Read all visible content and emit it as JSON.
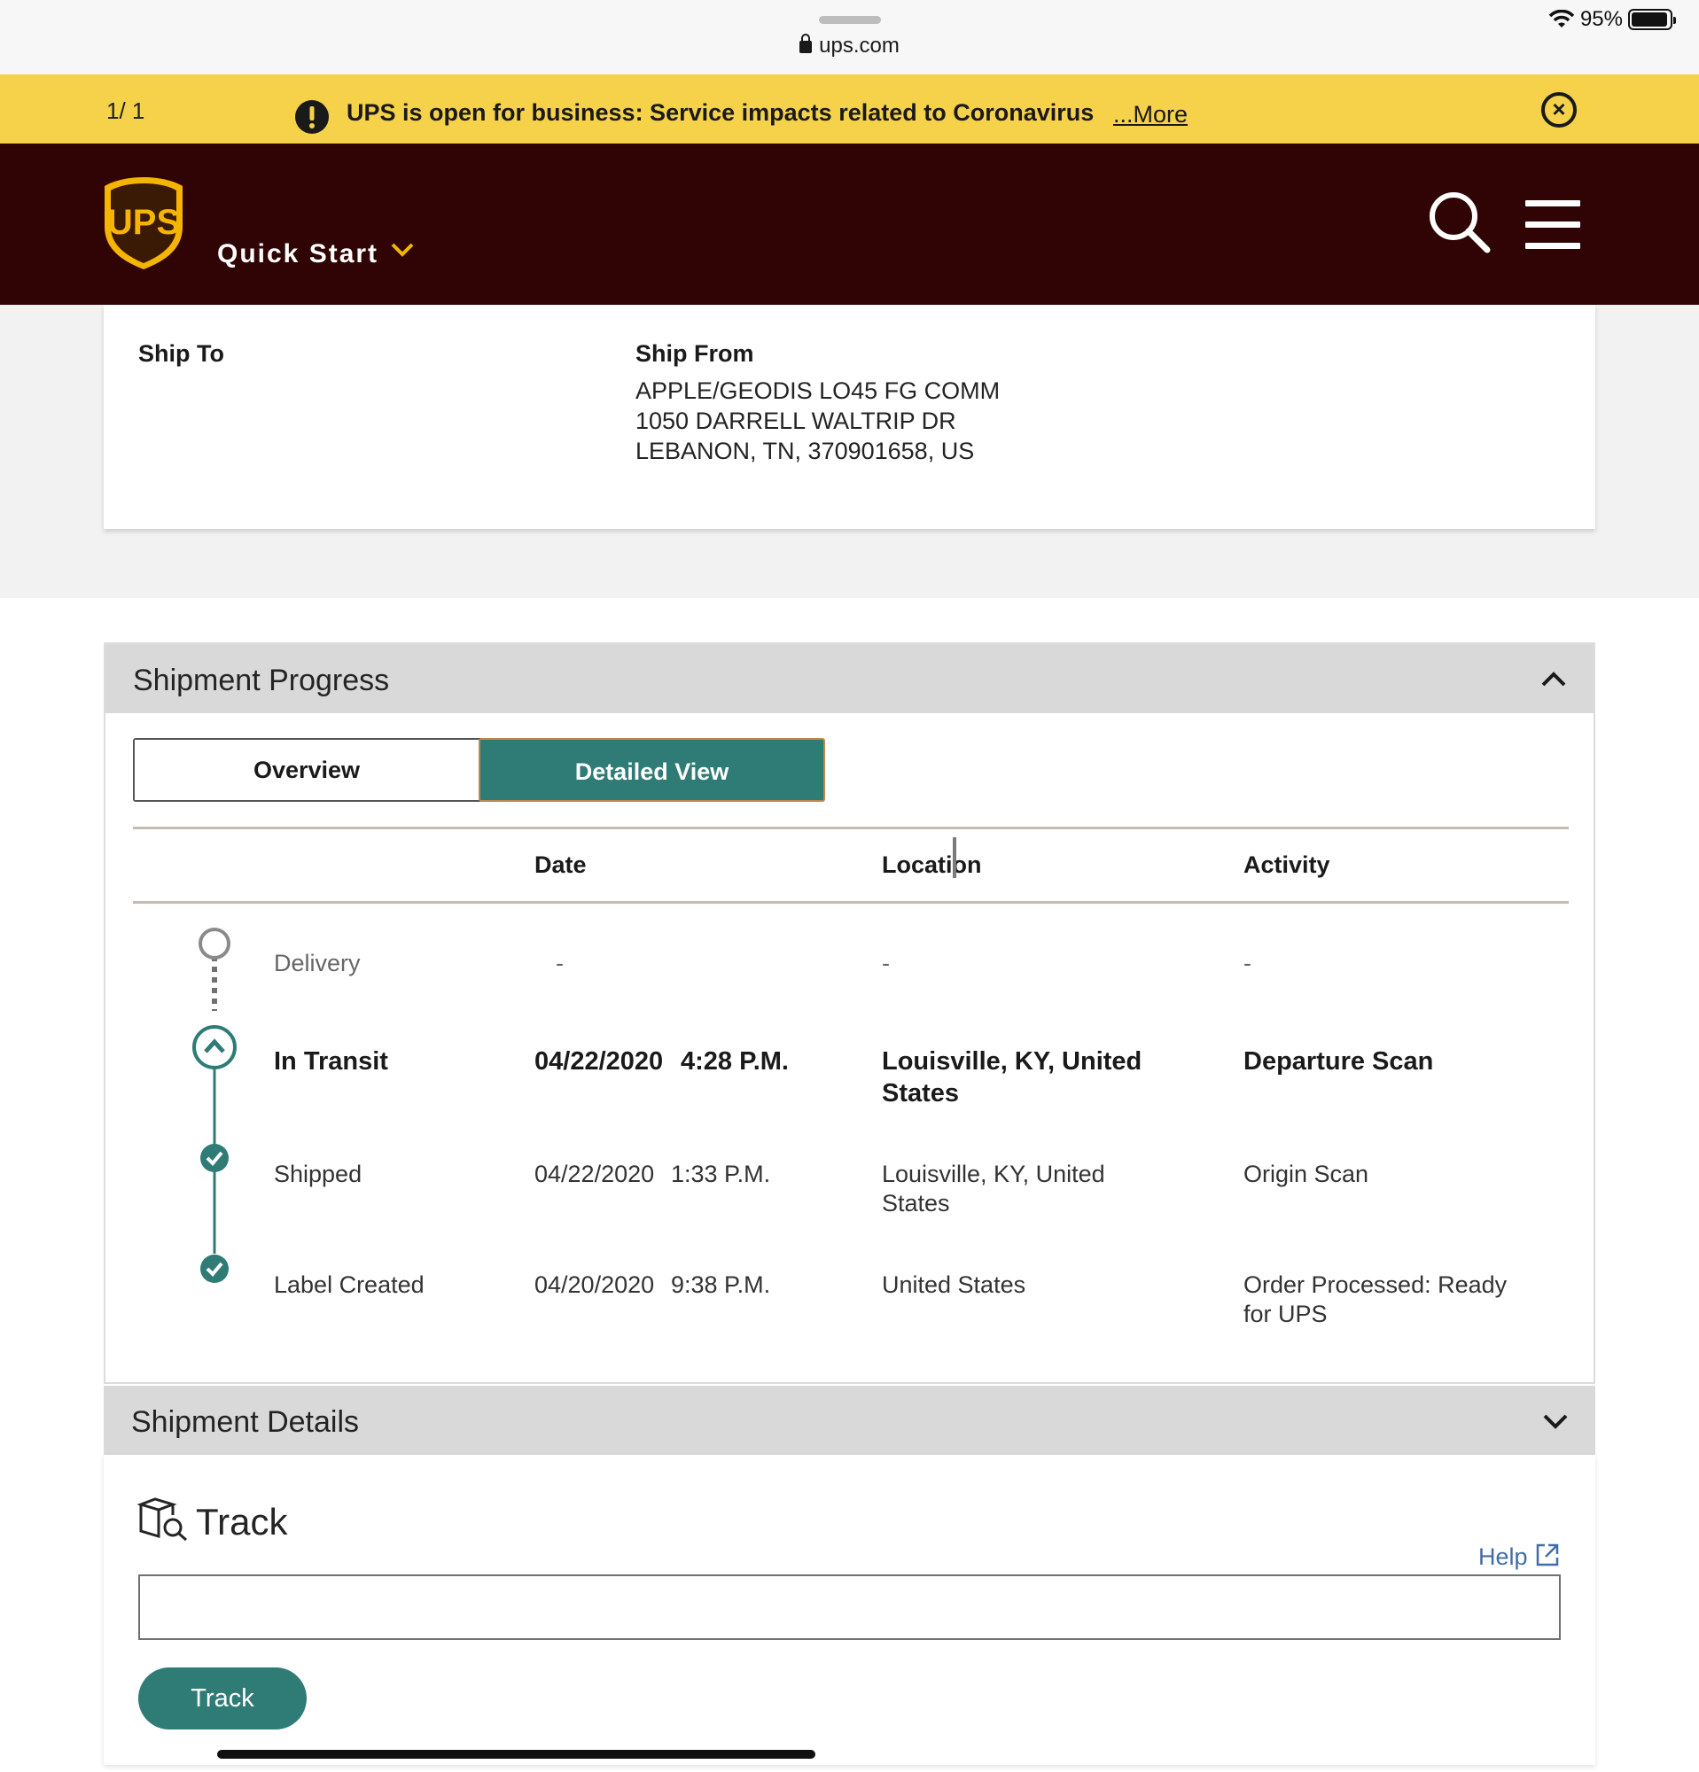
{
  "browser": {
    "url": "ups.com",
    "battery": "95%",
    "battery_level": 0.95
  },
  "alert": {
    "count": "1/ 1",
    "message": "UPS is open for business: Service impacts related to Coronavirus",
    "more_link": "...More",
    "color": "#f5d24a"
  },
  "header": {
    "quick_start": "Quick Start",
    "brand_color": "#300404",
    "logo_text": "UPS"
  },
  "shipment": {
    "ship_to_label": "Ship To",
    "ship_from_label": "Ship From",
    "ship_from_lines": [
      "APPLE/GEODIS LO45 FG COMM",
      "1050 DARRELL WALTRIP DR",
      "LEBANON, TN, 370901658, US"
    ]
  },
  "progress": {
    "title": "Shipment Progress",
    "tabs": {
      "overview": "Overview",
      "detailed": "Detailed View"
    },
    "columns": {
      "date": "Date",
      "location": "Location",
      "activity": "Activity"
    },
    "rows": [
      {
        "status": "Delivery",
        "date": "-",
        "time": "",
        "location": "-",
        "location2": "",
        "activity": "-",
        "activity2": ""
      },
      {
        "status": "In Transit",
        "date": "04/22/2020",
        "time": "4:28 P.M.",
        "location": "Louisville, KY, United",
        "location2": "States",
        "activity": "Departure Scan",
        "activity2": ""
      },
      {
        "status": "Shipped",
        "date": "04/22/2020",
        "time": "1:33 P.M.",
        "location": "Louisville, KY, United",
        "location2": "States",
        "activity": "Origin Scan",
        "activity2": ""
      },
      {
        "status": "Label Created",
        "date": "04/20/2020",
        "time": "9:38 P.M.",
        "location": "United States",
        "location2": "",
        "activity": "Order Processed: Ready",
        "activity2": "for UPS"
      }
    ],
    "accent": "#2f7b76"
  },
  "details": {
    "title": "Shipment Details",
    "track_title": "Track",
    "help": "Help",
    "track_button": "Track",
    "input_value": ""
  }
}
